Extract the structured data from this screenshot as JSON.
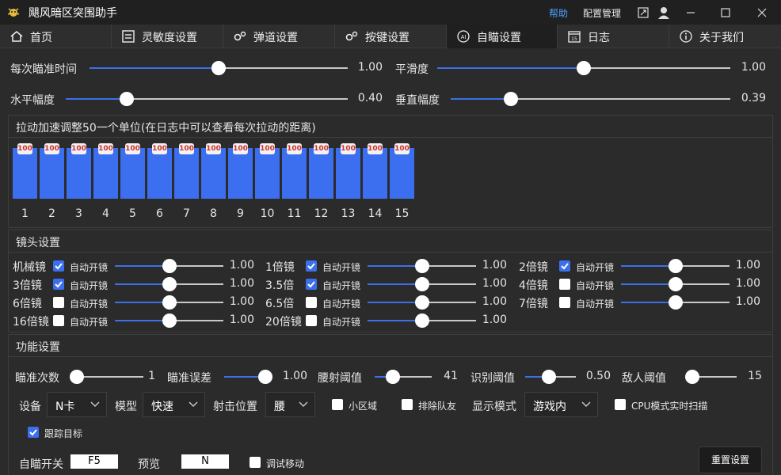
{
  "app": {
    "title": "飓风暗区突围助手"
  },
  "titlebar": {
    "help_label": "帮助",
    "config_label": "配置管理"
  },
  "tabs": [
    {
      "label": "首页",
      "icon": "home-icon",
      "active": false
    },
    {
      "label": "灵敏度设置",
      "icon": "sliders-icon",
      "active": false
    },
    {
      "label": "弹道设置",
      "icon": "gears-icon",
      "active": false
    },
    {
      "label": "按键设置",
      "icon": "gears-icon",
      "active": false
    },
    {
      "label": "自瞄设置",
      "icon": "ai-icon",
      "active": true
    },
    {
      "label": "日志",
      "icon": "calendar-icon",
      "active": false
    },
    {
      "label": "关于我们",
      "icon": "info-icon",
      "active": false
    }
  ],
  "top_sliders": [
    {
      "label": "每次瞄准时间",
      "value": "1.00",
      "fraction": 0.5
    },
    {
      "label": "平滑度",
      "value": "1.00",
      "fraction": 0.5
    },
    {
      "label": "水平幅度",
      "value": "0.40",
      "fraction": 0.2
    },
    {
      "label": "垂直幅度",
      "value": "0.39",
      "fraction": 0.2
    }
  ],
  "accel": {
    "title": "拉动加速调整50一个单位(在日志中可以查看每次拉动的距离)",
    "bars": [
      {
        "index": "1",
        "value": "100"
      },
      {
        "index": "2",
        "value": "100"
      },
      {
        "index": "3",
        "value": "100"
      },
      {
        "index": "4",
        "value": "100"
      },
      {
        "index": "5",
        "value": "100"
      },
      {
        "index": "6",
        "value": "100"
      },
      {
        "index": "7",
        "value": "100"
      },
      {
        "index": "8",
        "value": "100"
      },
      {
        "index": "9",
        "value": "100"
      },
      {
        "index": "10",
        "value": "100"
      },
      {
        "index": "11",
        "value": "100"
      },
      {
        "index": "12",
        "value": "100"
      },
      {
        "index": "13",
        "value": "100"
      },
      {
        "index": "14",
        "value": "100"
      },
      {
        "index": "15",
        "value": "100"
      }
    ]
  },
  "scope": {
    "title": "镜头设置",
    "auto_label": "自动开镜",
    "items": [
      {
        "label": "机械镜",
        "checked": true,
        "value": "1.00",
        "fraction": 0.5
      },
      {
        "label": "1倍镜",
        "checked": true,
        "value": "1.00",
        "fraction": 0.5
      },
      {
        "label": "2倍镜",
        "checked": true,
        "value": "1.00",
        "fraction": 0.5
      },
      {
        "label": "3倍镜",
        "checked": true,
        "value": "1.00",
        "fraction": 0.5
      },
      {
        "label": "3.5倍",
        "checked": true,
        "value": "1.00",
        "fraction": 0.5
      },
      {
        "label": "4倍镜",
        "checked": false,
        "value": "1.00",
        "fraction": 0.5
      },
      {
        "label": "6倍镜",
        "checked": false,
        "value": "1.00",
        "fraction": 0.5
      },
      {
        "label": "6.5倍",
        "checked": false,
        "value": "1.00",
        "fraction": 0.5
      },
      {
        "label": "7倍镜",
        "checked": false,
        "value": "1.00",
        "fraction": 0.5
      },
      {
        "label": "16倍镜",
        "checked": false,
        "value": "1.00",
        "fraction": 0.5
      },
      {
        "label": "20倍镜",
        "checked": false,
        "value": "1.00",
        "fraction": 0.5
      }
    ]
  },
  "func": {
    "title": "功能设置",
    "sliders": [
      {
        "label": "瞄准次数",
        "value": "1",
        "fraction": 0.0
      },
      {
        "label": "瞄准误差",
        "value": "1.00",
        "fraction": 1.0
      },
      {
        "label": "腰射阈值",
        "value": "41",
        "fraction": 0.25
      },
      {
        "label": "识别阈值",
        "value": "0.50",
        "fraction": 0.45
      },
      {
        "label": "敌人阈值",
        "value": "15",
        "fraction": 0.0
      }
    ],
    "device_label": "设备",
    "device_value": "N卡",
    "model_label": "模型",
    "model_value": "快速",
    "shoot_label": "射击位置",
    "shoot_value": "腰",
    "small_area_label": "小区域",
    "small_area_checked": false,
    "exclude_team_label": "排除队友",
    "exclude_team_checked": false,
    "display_label": "显示模式",
    "display_value": "游戏内",
    "cpu_scan_label": "CPU模式实时扫描",
    "cpu_scan_checked": false,
    "track_label": "跟踪目标",
    "track_checked": true,
    "aim_switch_label": "自瞄开关",
    "aim_switch_key": "F5",
    "preview_label": "预览",
    "preview_key": "N",
    "debug_move_label": "调试移动",
    "debug_move_checked": false,
    "reset_label": "重置设置"
  },
  "colors": {
    "accent": "#3c6ff0",
    "background": "#2b2b2b",
    "titlebar": "#202020",
    "link": "#4aa0ff"
  }
}
